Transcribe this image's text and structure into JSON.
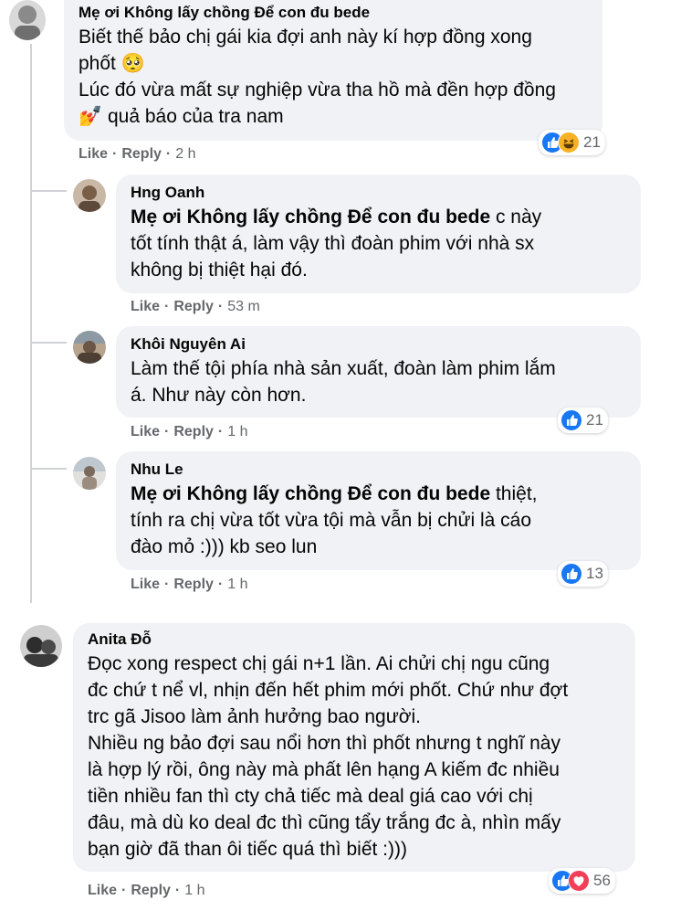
{
  "colors": {
    "like_blue": "#1877f2",
    "haha_yellow": "#f7b125",
    "love_red": "#f33e58",
    "bubble_bg": "#f0f2f5",
    "meta_gray": "#65676b"
  },
  "comments": [
    {
      "author": "Mẹ ơi Không lấy chồng Để con đu bede",
      "lines": [
        "Biết thế bảo chị gái kia đợi anh này kí hợp đồng xong",
        "phốt 🥺",
        "Lúc đó vừa mất sự nghiệp vừa tha hồ mà đền hợp đồng",
        "💅 quả báo của tra nam"
      ],
      "like": "Like",
      "reply": "Reply",
      "time": "2 h",
      "reactions": [
        "like-icon",
        "haha-icon"
      ],
      "reaction_count": "21"
    },
    {
      "author": "Hng Oanh",
      "mention": "Mẹ ơi Không lấy chồng Để con đu bede",
      "lines": [
        " c này",
        "tốt tính thật á, làm vậy thì đoàn phim với nhà sx",
        "không bị thiệt hại đó."
      ],
      "like": "Like",
      "reply": "Reply",
      "time": "53 m"
    },
    {
      "author": "Khôi Nguyên Ai",
      "lines": [
        "Làm thế tội phía nhà sản xuất, đoàn làm phim lắm",
        "á. Như này còn hơn."
      ],
      "like": "Like",
      "reply": "Reply",
      "time": "1 h",
      "reactions": [
        "like-icon"
      ],
      "reaction_count": "21"
    },
    {
      "author": "Nhu Le",
      "mention": "Mẹ ơi Không lấy chồng Để con đu bede",
      "lines": [
        " thiệt,",
        "tính ra chị vừa tốt vừa tội mà vẫn bị chửi là cáo",
        "đào mỏ :))) kb seo lun"
      ],
      "like": "Like",
      "reply": "Reply",
      "time": "1 h",
      "reactions": [
        "like-icon"
      ],
      "reaction_count": "13"
    },
    {
      "author": "Anita Đỗ",
      "lines": [
        "Đọc xong respect chị gái n+1 lần. Ai chửi chị ngu cũng",
        "đc chứ t nể vl, nhịn đến hết phim mới phốt. Chứ như đợt",
        "trc gã Jisoo làm ảnh hưởng bao người.",
        "Nhiều ng bảo đợi sau nổi hơn thì phốt nhưng t nghĩ này",
        "là hợp lý rồi, ông này mà phất lên hạng A kiếm đc nhiều",
        "tiền nhiều fan thì cty chả tiếc mà deal giá cao với chị",
        "đâu, mà dù ko deal đc thì cũng tẩy trắng đc à, nhìn mấy",
        "bạn giờ đã than ôi tiếc quá thì biết :)))"
      ],
      "like": "Like",
      "reply": "Reply",
      "time": "1 h",
      "reactions": [
        "like-icon",
        "love-icon"
      ],
      "reaction_count": "56"
    }
  ],
  "separator": "·"
}
